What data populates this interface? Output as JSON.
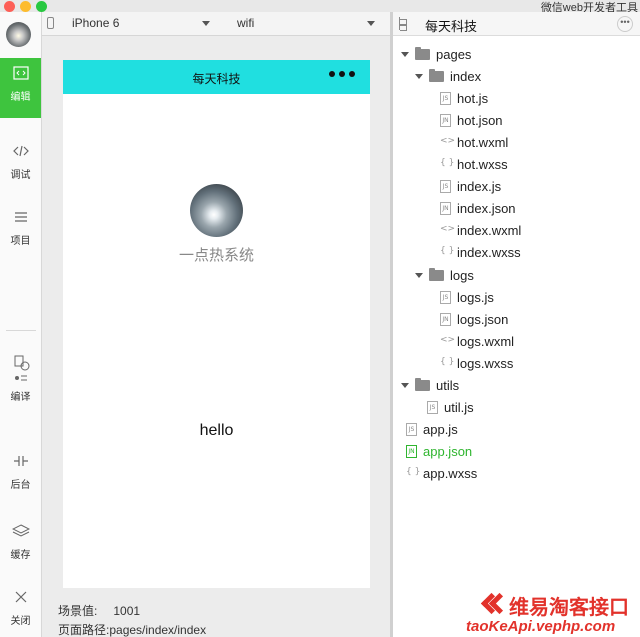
{
  "window": {
    "title": "微信web开发者工具"
  },
  "sidebar": {
    "items": [
      {
        "label": "编辑",
        "icon": "code-icon",
        "active": true
      },
      {
        "label": "调试",
        "icon": "debug-icon"
      },
      {
        "label": "项目",
        "icon": "menu-icon"
      },
      {
        "label": "编译",
        "icon": "compile-icon"
      },
      {
        "label": "后台",
        "icon": "background-icon"
      },
      {
        "label": "缓存",
        "icon": "layers-icon"
      },
      {
        "label": "关闭",
        "icon": "close-icon"
      }
    ]
  },
  "toolbar": {
    "device": "iPhone 6",
    "network": "wifi"
  },
  "app": {
    "nav_title": "每天科技",
    "nav_bg": "#20dfe0",
    "nickname": "一点热系统",
    "message": "hello"
  },
  "status": {
    "scene_label": "场景值:",
    "scene_value": "1001",
    "path_label": "页面路径:",
    "path_value": "pages/index/index"
  },
  "files": {
    "title": "每天科技",
    "tree": [
      {
        "name": "pages",
        "type": "folder"
      },
      {
        "name": "index",
        "type": "folder"
      },
      {
        "name": "hot.js",
        "type": "js"
      },
      {
        "name": "hot.json",
        "type": "json"
      },
      {
        "name": "hot.wxml",
        "type": "wxml"
      },
      {
        "name": "hot.wxss",
        "type": "wxss"
      },
      {
        "name": "index.js",
        "type": "js"
      },
      {
        "name": "index.json",
        "type": "json"
      },
      {
        "name": "index.wxml",
        "type": "wxml"
      },
      {
        "name": "index.wxss",
        "type": "wxss"
      },
      {
        "name": "logs",
        "type": "folder"
      },
      {
        "name": "logs.js",
        "type": "js"
      },
      {
        "name": "logs.json",
        "type": "json"
      },
      {
        "name": "logs.wxml",
        "type": "wxml"
      },
      {
        "name": "logs.wxss",
        "type": "wxss"
      },
      {
        "name": "utils",
        "type": "folder"
      },
      {
        "name": "util.js",
        "type": "js"
      },
      {
        "name": "app.js",
        "type": "js"
      },
      {
        "name": "app.json",
        "type": "json",
        "selected": true
      },
      {
        "name": "app.wxss",
        "type": "wxss"
      }
    ]
  },
  "watermark": {
    "brand": "维易淘客接口",
    "url": "taoKeApi.vephp.com"
  },
  "colors": {
    "accent_green": "#3ec43e",
    "selected_file": "#2fb52f",
    "brand_red": "#e2322b"
  }
}
